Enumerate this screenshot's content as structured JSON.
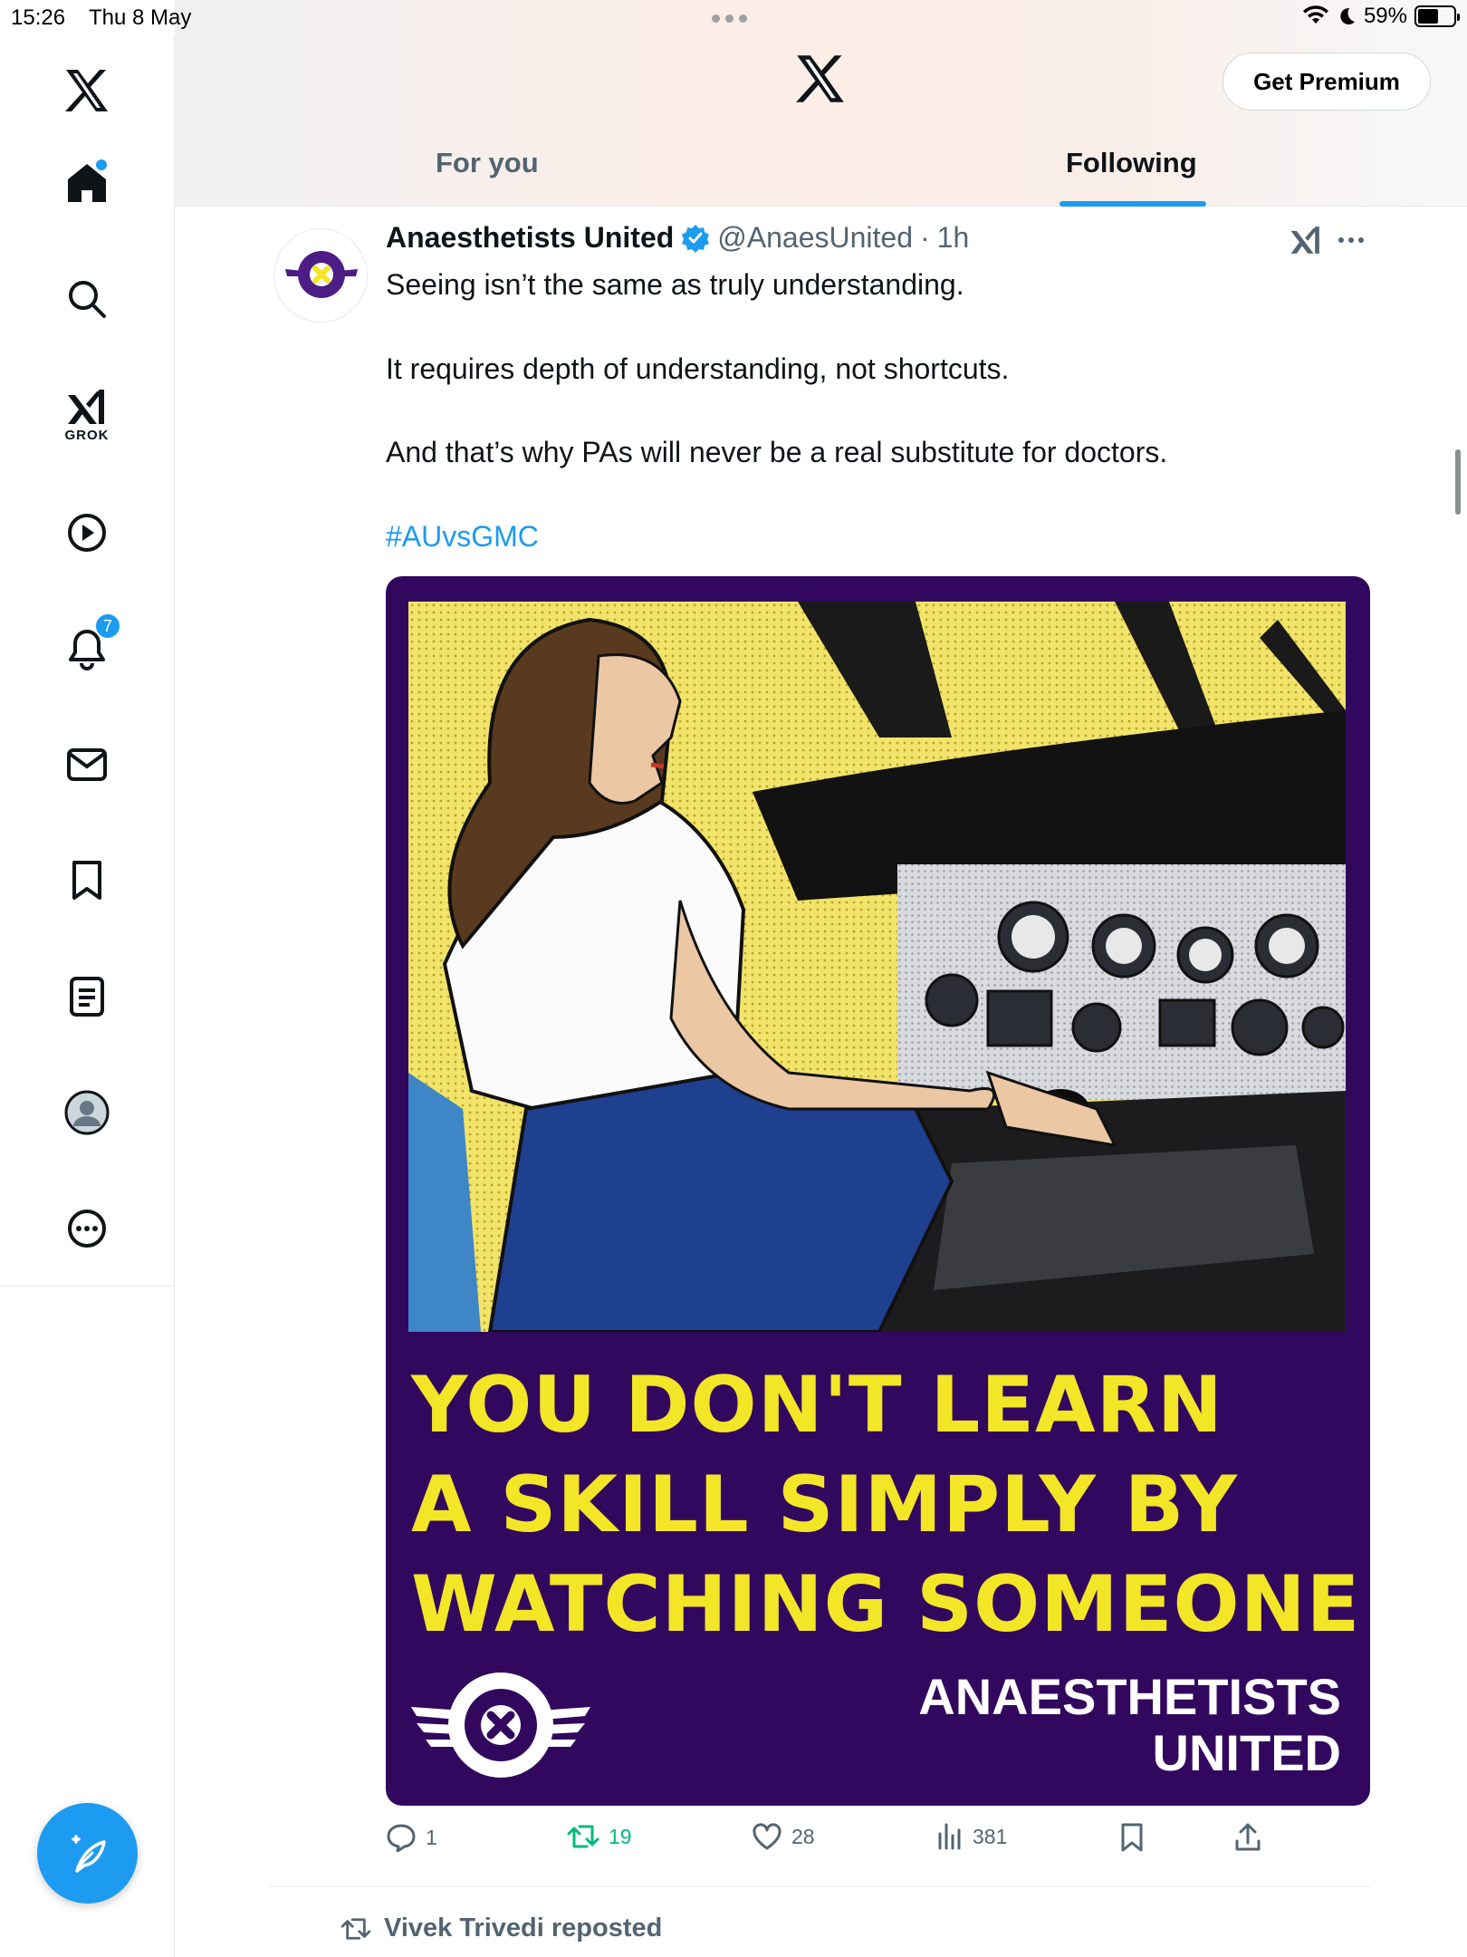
{
  "status_bar": {
    "time": "15:26",
    "date": "Thu 8 May",
    "battery": "59%"
  },
  "header": {
    "premium_label": "Get Premium"
  },
  "tabs": [
    {
      "label": "For you"
    },
    {
      "label": "Following"
    }
  ],
  "sidebar": {
    "items": [
      {
        "name": "home",
        "icon": "home-icon"
      },
      {
        "name": "search",
        "icon": "search-icon"
      },
      {
        "name": "grok",
        "icon": "grok-icon",
        "label": "GROK"
      },
      {
        "name": "video",
        "icon": "play-icon"
      },
      {
        "name": "notifications",
        "icon": "bell-icon",
        "badge": "7"
      },
      {
        "name": "messages",
        "icon": "envelope-icon"
      },
      {
        "name": "bookmarks",
        "icon": "bookmark-icon"
      },
      {
        "name": "lists",
        "icon": "list-icon"
      },
      {
        "name": "profile",
        "icon": "avatar-icon"
      },
      {
        "name": "more",
        "icon": "more-icon"
      }
    ]
  },
  "tweet": {
    "name": "Anaesthetists United",
    "handle": "@AnaesUnited",
    "time": "1h",
    "lines": [
      "Seeing isn’t the same as truly understanding.",
      "It requires depth of understanding, not shortcuts.",
      "And that’s why PAs will never be a real substitute for doctors."
    ],
    "hashtag": "#AUvsGMC",
    "media": {
      "headline": [
        "YOU DON'T LEARN",
        "A SKILL SIMPLY BY",
        "WATCHING SOMEONE"
      ],
      "brand": [
        "ANAESTHETISTS",
        "UNITED"
      ],
      "logo_text": [
        "ANAESTHETISTS",
        "UNITED"
      ]
    },
    "stats": {
      "replies": "1",
      "reposts": "19",
      "likes": "28",
      "views": "381"
    }
  },
  "next_item": {
    "repost_label": "Vivek Trivedi reposted"
  },
  "colors": {
    "accent": "#1d9bf0",
    "retweet": "#00ba7c",
    "card_bg": "#32085e",
    "headline": "#f3e626"
  }
}
